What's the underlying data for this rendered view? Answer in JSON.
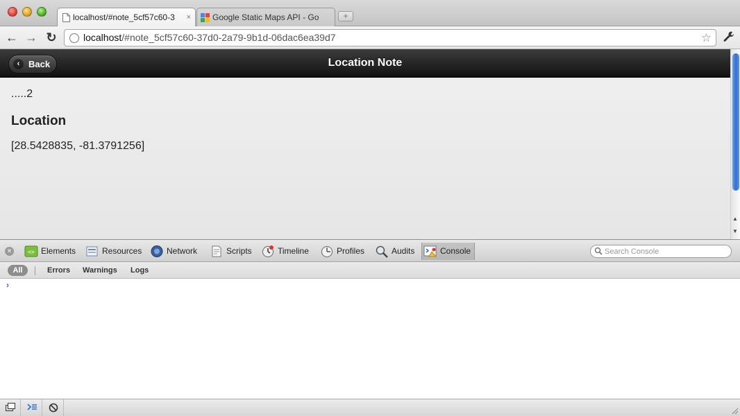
{
  "browser": {
    "tabs": [
      {
        "title": "localhost/#note_5cf57c60-3",
        "close": "×",
        "favicon": "page-icon",
        "active": true
      },
      {
        "title": "Google Static Maps API - Go",
        "favicon": "google-favicon",
        "active": false
      }
    ],
    "new_tab_label": "+",
    "url_host": "localhost",
    "url_path": "/#note_5cf57c60-37d0-2a79-9b1d-06dac6ea39d7",
    "back_icon": "←",
    "forward_icon": "→",
    "reload_icon": "↻",
    "star_icon": "☆",
    "wrench_icon": "🔧"
  },
  "page": {
    "header_title": "Location Note",
    "back_label": "Back",
    "back_icon": "‹",
    "note_text": ".....2",
    "location_heading": "Location",
    "coordinates": "[28.5428835, -81.3791256]"
  },
  "devtools": {
    "close_icon": "×",
    "panels": [
      {
        "label": "Elements"
      },
      {
        "label": "Resources"
      },
      {
        "label": "Network"
      },
      {
        "label": "Scripts"
      },
      {
        "label": "Timeline"
      },
      {
        "label": "Profiles"
      },
      {
        "label": "Audits"
      },
      {
        "label": "Console",
        "selected": true
      }
    ],
    "search_placeholder": "Search Console",
    "filters": [
      "All",
      "Errors",
      "Warnings",
      "Logs"
    ],
    "prompt": "›"
  },
  "colors": {
    "header_dark": "#111111",
    "console_prompt": "#2a6ed8",
    "scroll_thumb": "#2f6fd6"
  }
}
